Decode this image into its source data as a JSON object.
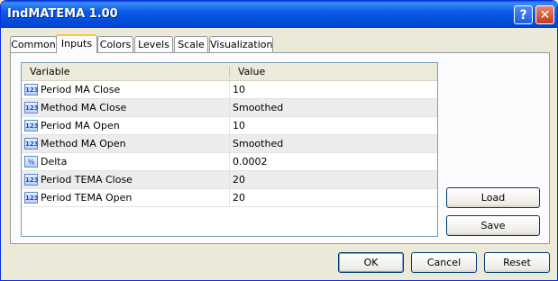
{
  "window": {
    "title": "IndMATEMA 1.00",
    "help_glyph": "?",
    "close_glyph": "✕"
  },
  "tabs": [
    "Common",
    "Inputs",
    "Colors",
    "Levels",
    "Scale",
    "Visualization"
  ],
  "active_tab": "Inputs",
  "table": {
    "columns": [
      "Variable",
      "Value"
    ],
    "rows": [
      {
        "icon": "integer-icon",
        "icon_glyph": "123",
        "name": "Period MA Close",
        "value": "10"
      },
      {
        "icon": "integer-icon",
        "icon_glyph": "123",
        "name": "Method MA Close",
        "value": "Smoothed"
      },
      {
        "icon": "integer-icon",
        "icon_glyph": "123",
        "name": "Period MA Open",
        "value": "10"
      },
      {
        "icon": "integer-icon",
        "icon_glyph": "123",
        "name": "Method MA Open",
        "value": "Smoothed"
      },
      {
        "icon": "double-icon",
        "icon_glyph": "½",
        "name": "Delta",
        "value": "0.0002"
      },
      {
        "icon": "integer-icon",
        "icon_glyph": "123",
        "name": "Period TEMA Close",
        "value": "20"
      },
      {
        "icon": "integer-icon",
        "icon_glyph": "123",
        "name": "Period TEMA Open",
        "value": "20"
      }
    ]
  },
  "side_buttons": {
    "load": "Load",
    "save": "Save"
  },
  "footer_buttons": {
    "ok": "OK",
    "cancel": "Cancel",
    "reset": "Reset"
  }
}
